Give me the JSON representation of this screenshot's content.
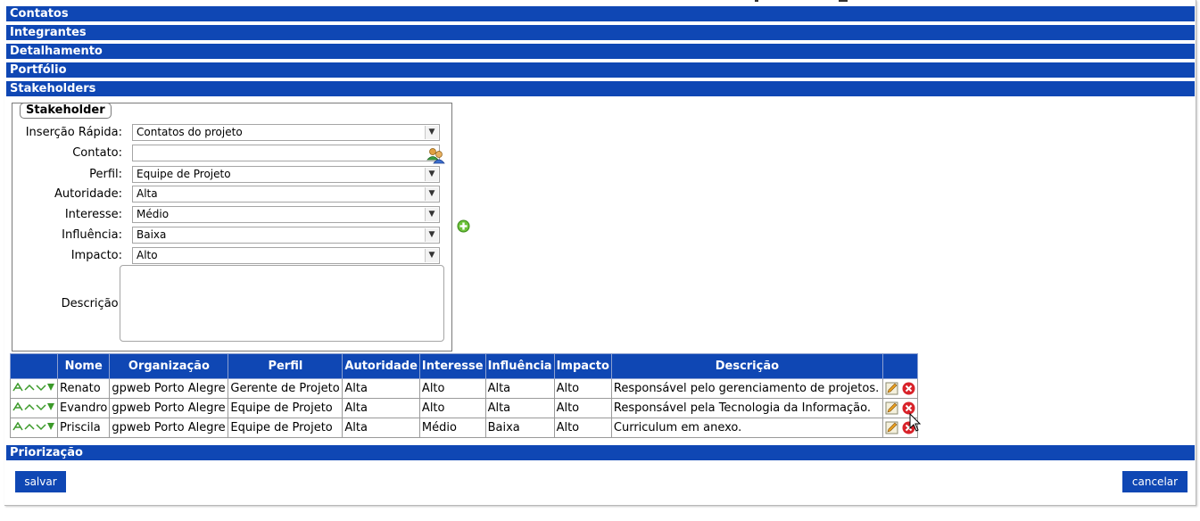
{
  "sections": {
    "contatos": "Contatos",
    "integrantes": "Integrantes",
    "detalhamento": "Detalhamento",
    "portfolio": "Portfólio",
    "stakeholders": "Stakeholders",
    "priorizacao": "Priorização"
  },
  "stakeholder_form": {
    "legend": "Stakeholder",
    "insercao_rapida": {
      "label": "Inserção Rápida:",
      "value": "Contatos do projeto"
    },
    "contato": {
      "label": "Contato:",
      "value": ""
    },
    "perfil": {
      "label": "Perfil:",
      "value": "Equipe de Projeto"
    },
    "autoridade": {
      "label": "Autoridade:",
      "value": "Alta"
    },
    "interesse": {
      "label": "Interesse:",
      "value": "Médio"
    },
    "influencia": {
      "label": "Influência:",
      "value": "Baixa"
    },
    "impacto": {
      "label": "Impacto:",
      "value": "Alto"
    },
    "descricao": {
      "label": "Descrição:",
      "value": ""
    }
  },
  "table": {
    "headers": [
      "",
      "Nome",
      "Organização",
      "Perfil",
      "Autoridade",
      "Interesse",
      "Influência",
      "Impacto",
      "Descrição",
      ""
    ],
    "rows": [
      {
        "nome": "Renato",
        "organizacao": "gpweb Porto Alegre",
        "perfil": "Gerente de Projeto",
        "autoridade": "Alta",
        "interesse": "Alto",
        "influencia": "Alta",
        "impacto": "Alto",
        "descricao": "Responsável pelo gerenciamento de projetos."
      },
      {
        "nome": "Evandro",
        "organizacao": "gpweb Porto Alegre",
        "perfil": "Equipe de Projeto",
        "autoridade": "Alta",
        "interesse": "Alto",
        "influencia": "Alta",
        "impacto": "Alto",
        "descricao": "Responsável pela Tecnologia da Informação."
      },
      {
        "nome": "Priscila",
        "organizacao": "gpweb Porto Alegre",
        "perfil": "Equipe de Projeto",
        "autoridade": "Alta",
        "interesse": "Médio",
        "influencia": "Baixa",
        "impacto": "Alto",
        "descricao": "Curriculum em anexo."
      }
    ]
  },
  "buttons": {
    "salvar": "salvar",
    "cancelar": "cancelar"
  },
  "colors": {
    "bar_blue": "#0f47b4"
  },
  "icons": {
    "order": "order-arrows-icon",
    "edit": "edit-pencil-icon",
    "delete": "delete-x-icon",
    "add": "add-plus-icon",
    "contacts": "contacts-people-icon"
  }
}
